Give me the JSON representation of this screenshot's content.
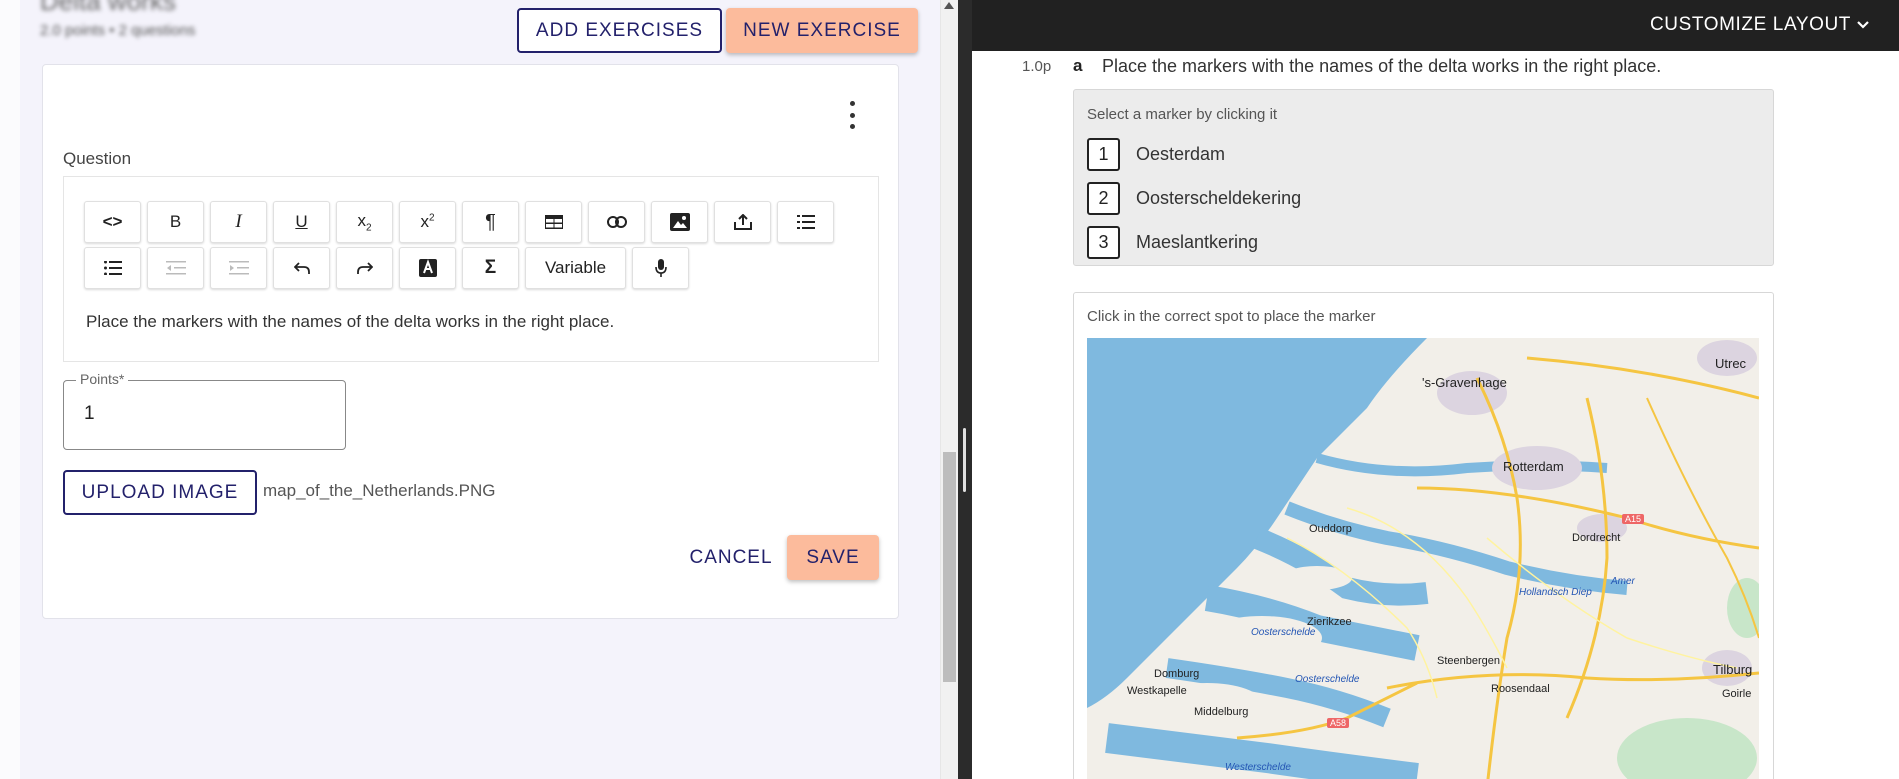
{
  "left": {
    "header_title": "Delta works",
    "header_meta": "2.0 points • 2 questions",
    "add_exercises_label": "ADD EXERCISES",
    "new_exercise_label": "NEW EXERCISE"
  },
  "editor": {
    "question_label": "Question",
    "toolbar_variable_label": "Variable",
    "content": "Place the markers with the names of the delta works in the right place."
  },
  "points": {
    "label": "Points*",
    "value": "1"
  },
  "upload": {
    "button_label": "UPLOAD IMAGE",
    "filename": "map_of_the_Netherlands.PNG"
  },
  "actions": {
    "cancel_label": "CANCEL",
    "save_label": "SAVE"
  },
  "preview": {
    "customize_label": "CUSTOMIZE LAYOUT",
    "question_points": "1.0p",
    "question_letter": "a",
    "question_text": "Place the markers with the names of the delta works in the right place.",
    "marker_hint": "Select a marker by clicking it",
    "markers": [
      {
        "number": "1",
        "name": "Oesterdam"
      },
      {
        "number": "2",
        "name": "Oosterscheldekering"
      },
      {
        "number": "3",
        "name": "Maeslantkering"
      }
    ],
    "map_hint": "Click in the correct spot to place the marker"
  },
  "map": {
    "cities": {
      "gravenhage": "'s-Gravenhage",
      "utrecht": "Utrec",
      "rotterdam": "Rotterdam",
      "ouddorp": "Ouddorp",
      "dordrecht": "Dordrecht",
      "zierikzee": "Zierikzee",
      "steenbergen": "Steenbergen",
      "domburg": "Domburg",
      "westkapelle": "Westkapelle",
      "middelburg": "Middelburg",
      "roosendaal": "Roosendaal",
      "tilburg": "Tilburg",
      "goirle": "Goirle"
    },
    "waters": {
      "hollandsch_diep": "Hollandsch Diep",
      "amer": "Amer",
      "oosterschelde_1": "Oosterschelde",
      "oosterschelde_2": "Oosterschelde",
      "westerschelde": "Westerschelde"
    },
    "roads": {
      "a15": "A15",
      "a58": "A58"
    }
  }
}
